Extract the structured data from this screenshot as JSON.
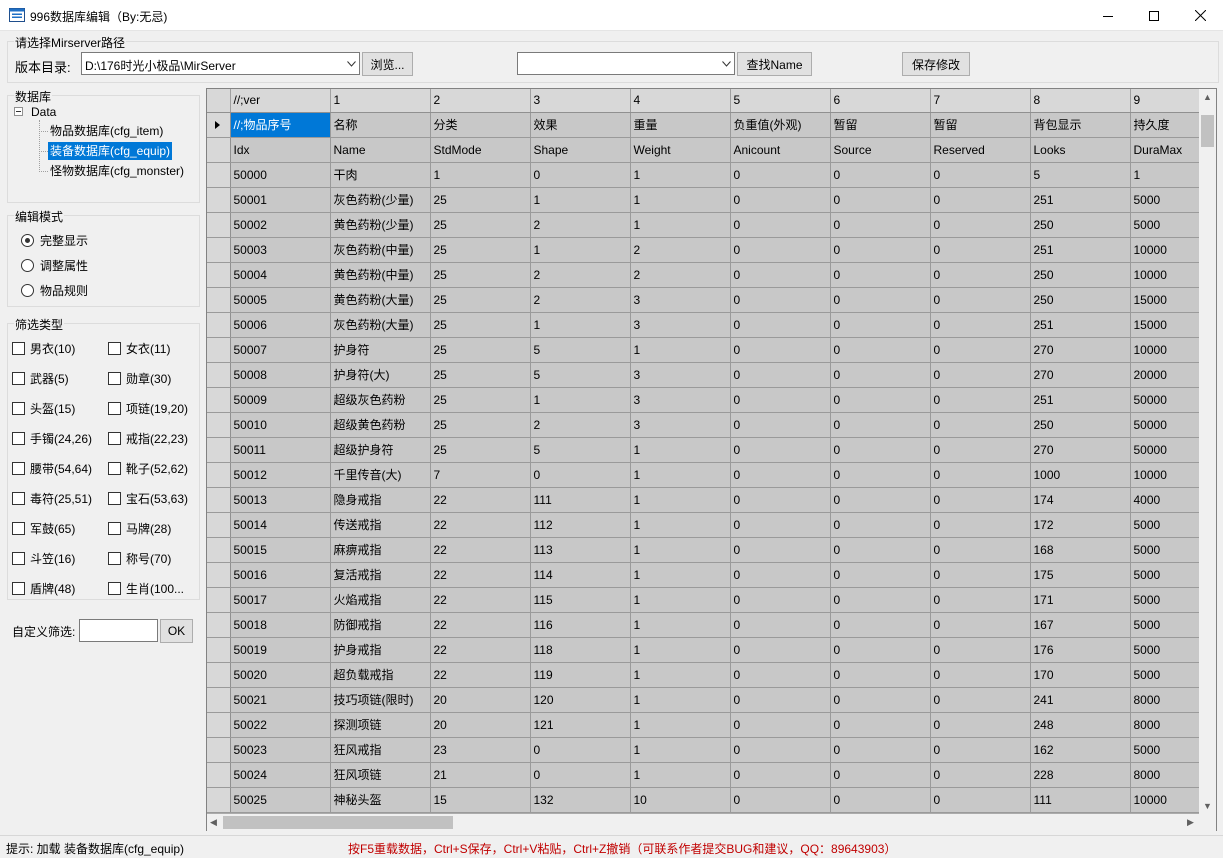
{
  "window": {
    "title": "996数据库编辑（By:无忌)",
    "icon": "database-app-icon",
    "controls": [
      "minimize-icon",
      "maximize-icon",
      "close-icon"
    ]
  },
  "path_group": {
    "legend": "请选择Mirserver路径",
    "version_label": "版本目录:",
    "version_value": "D:\\176时光小极品\\MirServer",
    "browse_label": "浏览...",
    "name_combo_value": "",
    "find_name_label": "查找Name",
    "save_label": "保存修改"
  },
  "database_group": {
    "legend": "数据库",
    "root": "Data",
    "items": [
      {
        "label": "物品数据库(cfg_item)",
        "selected": false
      },
      {
        "label": "装备数据库(cfg_equip)",
        "selected": true
      },
      {
        "label": "怪物数据库(cfg_monster)",
        "selected": false
      }
    ]
  },
  "edit_mode_group": {
    "legend": "编辑模式",
    "options": [
      {
        "label": "完整显示",
        "checked": true
      },
      {
        "label": "调整属性",
        "checked": false
      },
      {
        "label": "物品规则",
        "checked": false
      }
    ]
  },
  "filter_group": {
    "legend": "筛选类型",
    "left": [
      "男衣(10)",
      "武器(5)",
      "头盔(15)",
      "手镯(24,26)",
      "腰带(54,64)",
      "毒符(25,51)",
      "军鼓(65)",
      "斗笠(16)",
      "盾牌(48)"
    ],
    "right": [
      "女衣(11)",
      "勋章(30)",
      "项链(19,20)",
      "戒指(22,23)",
      "靴子(52,62)",
      "宝石(53,63)",
      "马牌(28)",
      "称号(70)",
      "生肖(100..."
    ],
    "custom_label": "自定义筛选:",
    "custom_value": "",
    "ok_label": "OK"
  },
  "grid": {
    "header": [
      "//;ver",
      "1",
      "2",
      "3",
      "4",
      "5",
      "6",
      "7",
      "8",
      "9"
    ],
    "rows": [
      [
        "//;物品序号",
        "名称",
        "分类",
        "效果",
        "重量",
        "负重值(外观)",
        "暂留",
        "暂留",
        "背包显示",
        "持久度"
      ],
      [
        "Idx",
        "Name",
        "StdMode",
        "Shape",
        "Weight",
        "Anicount",
        "Source",
        "Reserved",
        "Looks",
        "DuraMax"
      ],
      [
        "50000",
        "干肉",
        "1",
        "0",
        "1",
        "0",
        "0",
        "0",
        "5",
        "1"
      ],
      [
        "50001",
        "灰色药粉(少量)",
        "25",
        "1",
        "1",
        "0",
        "0",
        "0",
        "251",
        "5000"
      ],
      [
        "50002",
        "黄色药粉(少量)",
        "25",
        "2",
        "1",
        "0",
        "0",
        "0",
        "250",
        "5000"
      ],
      [
        "50003",
        "灰色药粉(中量)",
        "25",
        "1",
        "2",
        "0",
        "0",
        "0",
        "251",
        "10000"
      ],
      [
        "50004",
        "黄色药粉(中量)",
        "25",
        "2",
        "2",
        "0",
        "0",
        "0",
        "250",
        "10000"
      ],
      [
        "50005",
        "黄色药粉(大量)",
        "25",
        "2",
        "3",
        "0",
        "0",
        "0",
        "250",
        "15000"
      ],
      [
        "50006",
        "灰色药粉(大量)",
        "25",
        "1",
        "3",
        "0",
        "0",
        "0",
        "251",
        "15000"
      ],
      [
        "50007",
        "护身符",
        "25",
        "5",
        "1",
        "0",
        "0",
        "0",
        "270",
        "10000"
      ],
      [
        "50008",
        "护身符(大)",
        "25",
        "5",
        "3",
        "0",
        "0",
        "0",
        "270",
        "20000"
      ],
      [
        "50009",
        "超级灰色药粉",
        "25",
        "1",
        "3",
        "0",
        "0",
        "0",
        "251",
        "50000"
      ],
      [
        "50010",
        "超级黄色药粉",
        "25",
        "2",
        "3",
        "0",
        "0",
        "0",
        "250",
        "50000"
      ],
      [
        "50011",
        "超级护身符",
        "25",
        "5",
        "1",
        "0",
        "0",
        "0",
        "270",
        "50000"
      ],
      [
        "50012",
        "千里传音(大)",
        "7",
        "0",
        "1",
        "0",
        "0",
        "0",
        "1000",
        "10000"
      ],
      [
        "50013",
        "隐身戒指",
        "22",
        "111",
        "1",
        "0",
        "0",
        "0",
        "174",
        "4000"
      ],
      [
        "50014",
        "传送戒指",
        "22",
        "112",
        "1",
        "0",
        "0",
        "0",
        "172",
        "5000"
      ],
      [
        "50015",
        "麻痹戒指",
        "22",
        "113",
        "1",
        "0",
        "0",
        "0",
        "168",
        "5000"
      ],
      [
        "50016",
        "复活戒指",
        "22",
        "114",
        "1",
        "0",
        "0",
        "0",
        "175",
        "5000"
      ],
      [
        "50017",
        "火焰戒指",
        "22",
        "115",
        "1",
        "0",
        "0",
        "0",
        "171",
        "5000"
      ],
      [
        "50018",
        "防御戒指",
        "22",
        "116",
        "1",
        "0",
        "0",
        "0",
        "167",
        "5000"
      ],
      [
        "50019",
        "护身戒指",
        "22",
        "118",
        "1",
        "0",
        "0",
        "0",
        "176",
        "5000"
      ],
      [
        "50020",
        "超负载戒指",
        "22",
        "119",
        "1",
        "0",
        "0",
        "0",
        "170",
        "5000"
      ],
      [
        "50021",
        "技巧项链(限时)",
        "20",
        "120",
        "1",
        "0",
        "0",
        "0",
        "241",
        "8000"
      ],
      [
        "50022",
        "探测项链",
        "20",
        "121",
        "1",
        "0",
        "0",
        "0",
        "248",
        "8000"
      ],
      [
        "50023",
        "狂风戒指",
        "23",
        "0",
        "1",
        "0",
        "0",
        "0",
        "162",
        "5000"
      ],
      [
        "50024",
        "狂风项链",
        "21",
        "0",
        "1",
        "0",
        "0",
        "0",
        "228",
        "8000"
      ],
      [
        "50025",
        "神秘头盔",
        "15",
        "132",
        "10",
        "0",
        "0",
        "0",
        "111",
        "10000"
      ]
    ]
  },
  "status": {
    "left": "提示: 加载 装备数据库(cfg_equip)",
    "center": "按F5重载数据，Ctrl+S保存，Ctrl+V粘贴，Ctrl+Z撤销（可联系作者提交BUG和建议，QQ：89643903）",
    "center_color": "#c00000"
  },
  "colors": {
    "selection": "#0078d7",
    "cell_bg": "#c8c8c8",
    "grid_bg": "#ababab"
  }
}
